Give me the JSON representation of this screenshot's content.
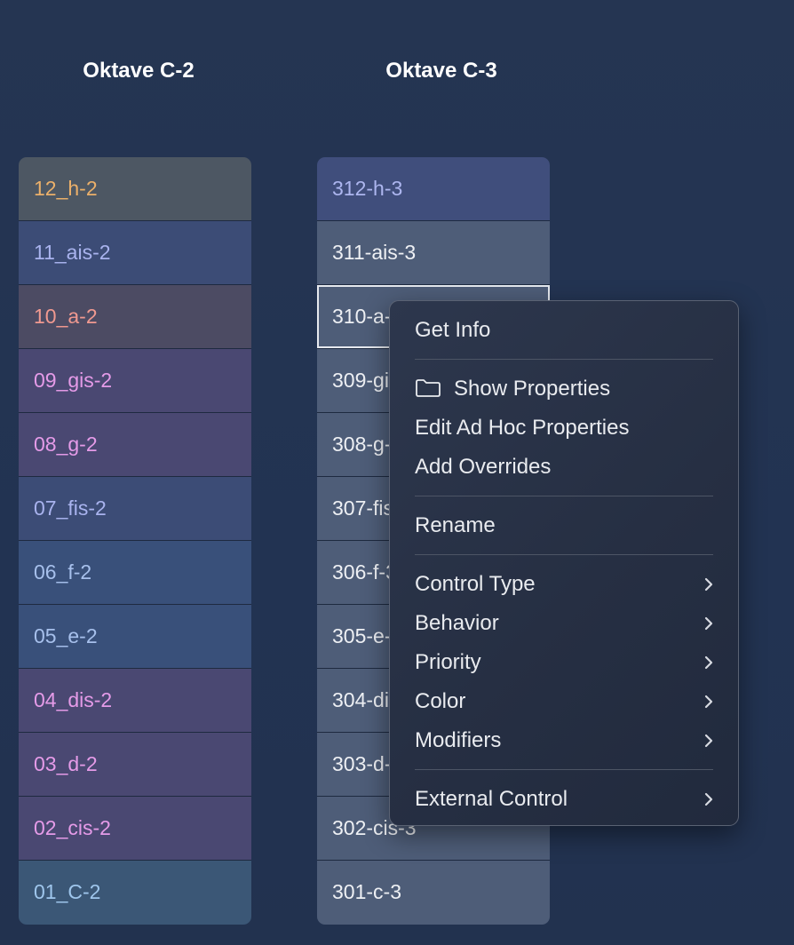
{
  "columns": {
    "c2": {
      "title": "Oktave C-2",
      "cells": [
        {
          "label": "12_h-2",
          "bg": "#4d5763",
          "fg": "#ebb06a"
        },
        {
          "label": "11_ais-2",
          "bg": "#3c4c76",
          "fg": "#a9b3ee"
        },
        {
          "label": "10_a-2",
          "bg": "#4c4b63",
          "fg": "#f09990"
        },
        {
          "label": "09_gis-2",
          "bg": "#4a4872",
          "fg": "#e59be8"
        },
        {
          "label": "08_g-2",
          "bg": "#4a4872",
          "fg": "#e59be8"
        },
        {
          "label": "07_fis-2",
          "bg": "#3c4c76",
          "fg": "#a9b3ee"
        },
        {
          "label": "06_f-2",
          "bg": "#39507a",
          "fg": "#a7c0ec"
        },
        {
          "label": "05_e-2",
          "bg": "#39507a",
          "fg": "#a7c0ec"
        },
        {
          "label": "04_dis-2",
          "bg": "#4a4872",
          "fg": "#e59be8"
        },
        {
          "label": "03_d-2",
          "bg": "#4a4872",
          "fg": "#e59be8"
        },
        {
          "label": "02_cis-2",
          "bg": "#4a4872",
          "fg": "#e59be8"
        },
        {
          "label": "01_C-2",
          "bg": "#3b5776",
          "fg": "#9fc6ec"
        }
      ]
    },
    "c3": {
      "title": "Oktave C-3",
      "cells": [
        {
          "label": "312-h-3",
          "bg": "#404e7c",
          "fg": "#adb6ef"
        },
        {
          "label": "311-ais-3",
          "bg": "#4e5d78",
          "fg": "#eef0f4"
        },
        {
          "label": "310-a-3",
          "bg": "#4e5d78",
          "fg": "#eef0f4"
        },
        {
          "label": "309-gis-3",
          "bg": "#4e5d78",
          "fg": "#eef0f4"
        },
        {
          "label": "308-g-3",
          "bg": "#4e5d78",
          "fg": "#eef0f4"
        },
        {
          "label": "307-fis-3",
          "bg": "#4e5d78",
          "fg": "#eef0f4"
        },
        {
          "label": "306-f-3",
          "bg": "#4e5d78",
          "fg": "#eef0f4"
        },
        {
          "label": "305-e-3",
          "bg": "#4e5d78",
          "fg": "#eef0f4"
        },
        {
          "label": "304-dis-3",
          "bg": "#4e5d78",
          "fg": "#eef0f4"
        },
        {
          "label": "303-d-3",
          "bg": "#4e5d78",
          "fg": "#eef0f4"
        },
        {
          "label": "302-cis-3",
          "bg": "#4e5d78",
          "fg": "#eef0f4"
        },
        {
          "label": "301-c-3",
          "bg": "#4e5d78",
          "fg": "#eef0f4"
        }
      ],
      "selected_index": 2
    }
  },
  "context_menu": {
    "groups": [
      [
        {
          "label": "Get Info",
          "submenu": false
        }
      ],
      [
        {
          "label": "Show Properties",
          "submenu": false,
          "icon": "folder-icon"
        },
        {
          "label": "Edit Ad Hoc Properties",
          "submenu": false
        },
        {
          "label": "Add Overrides",
          "submenu": false
        }
      ],
      [
        {
          "label": "Rename",
          "submenu": false
        }
      ],
      [
        {
          "label": "Control Type",
          "submenu": true
        },
        {
          "label": "Behavior",
          "submenu": true
        },
        {
          "label": "Priority",
          "submenu": true
        },
        {
          "label": "Color",
          "submenu": true
        },
        {
          "label": "Modifiers",
          "submenu": true
        }
      ],
      [
        {
          "label": "External Control",
          "submenu": true
        }
      ]
    ]
  }
}
